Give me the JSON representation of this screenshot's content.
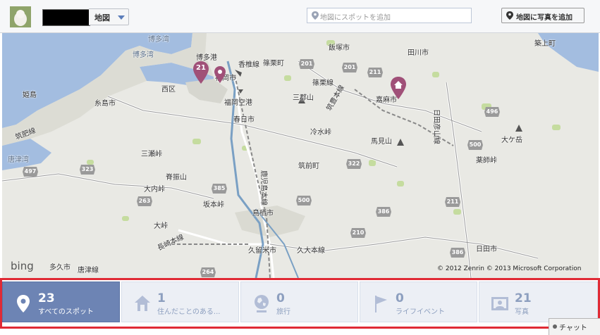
{
  "header": {
    "map_select_label": "地図",
    "search_placeholder": "地図にスポットを追加",
    "add_photo_label": "地図に写真を追加"
  },
  "map": {
    "labels": {
      "iizuka": "飯塚市",
      "tagawa": "田川市",
      "chikujo": "築上町",
      "hakata_bay": "博多湾",
      "hakata_port": "博多港",
      "sasaguri": "篠栗町",
      "sasaguri_line": "篠栗線",
      "fukuoka": "福岡市",
      "kashii": "香椎線",
      "nishi": "西区",
      "airport": "福岡空港",
      "kasuga": "春日市",
      "itoshima": "糸島市",
      "himeshima": "姫島",
      "sanko": "三郡山",
      "chikuho": "筑豊本線",
      "kama": "嘉麻市",
      "hitahiko": "日田彦山線",
      "reisui": "冷水峠",
      "chikuhi": "筑肥線",
      "karatsu_bay": "唐津湾",
      "sanzan": "三瀬峠",
      "sefuri": "脊振山",
      "chikuzen": "筑前町",
      "mami": "馬見山",
      "okuke": "大ケ岳",
      "yakushi": "薬師峠",
      "ochi": "大内峠",
      "kagoshima": "鹿児島本線",
      "sakamoto": "坂本峠",
      "tosu": "鳥栖市",
      "otoge": "大峠",
      "nagasaki": "長崎本線",
      "kurume": "久留米市",
      "kyudai": "久大本線",
      "hita": "日田市",
      "takukyu": "多久市",
      "karatsu_line": "唐津線"
    },
    "routes": [
      "201",
      "201",
      "211",
      "496",
      "322",
      "385",
      "500",
      "500",
      "323",
      "497",
      "263",
      "385",
      "386",
      "210",
      "211",
      "386",
      "264"
    ],
    "markers": {
      "cluster_count": "21"
    },
    "bing_logo": "bing",
    "credit": "© 2012 Zenrin   © 2013 Microsoft Corporation"
  },
  "tabs": [
    {
      "count": "23",
      "label": "すべてのスポット",
      "icon": "pin-icon",
      "active": true
    },
    {
      "count": "1",
      "label": "住んだことのある...",
      "icon": "house-icon",
      "active": false
    },
    {
      "count": "0",
      "label": "旅行",
      "icon": "globe-icon",
      "active": false
    },
    {
      "count": "0",
      "label": "ライフイベント",
      "icon": "flag-icon",
      "active": false
    },
    {
      "count": "21",
      "label": "写真",
      "icon": "photo-icon",
      "active": false
    }
  ],
  "chat": {
    "label": "チャット"
  },
  "colors": {
    "active_tab": "#6d84b4",
    "tab_bg": "#eceff5",
    "highlight_frame": "#e02a35",
    "marker": "#a05078",
    "water": "#a3bde0"
  }
}
